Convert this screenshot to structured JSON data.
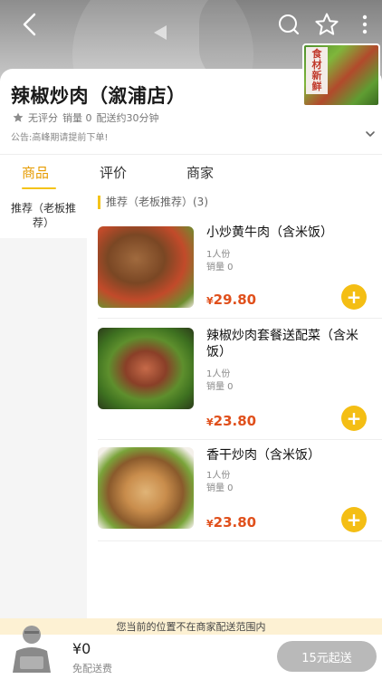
{
  "header": {
    "icons": [
      "back-icon",
      "search-icon",
      "star-icon",
      "more-icon"
    ]
  },
  "shop": {
    "name": "辣椒炒肉（溆浦店）",
    "rating": "无评分",
    "sales": "销量 0",
    "delivery": "配送约30分钟",
    "notice": "公告:高峰期请提前下单!",
    "logo_text": [
      "食",
      "材",
      "新",
      "鲜"
    ]
  },
  "tabs": [
    {
      "label": "商品",
      "active": true
    },
    {
      "label": "评价",
      "active": false
    },
    {
      "label": "商家",
      "active": false
    }
  ],
  "sidebar": {
    "items": [
      {
        "label": "推荐（老板推荐）",
        "active": true
      }
    ]
  },
  "section": {
    "title": "推荐（老板推荐）(3)"
  },
  "products": [
    {
      "name": "小炒黄牛肉（含米饭）",
      "portion": "1人份",
      "sales": "销量 0",
      "currency": "¥",
      "price": "29.80"
    },
    {
      "name": "辣椒炒肉套餐送配菜（含米饭）",
      "portion": "1人份",
      "sales": "销量 0",
      "currency": "¥",
      "price": "23.80"
    },
    {
      "name": "香干炒肉（含米饭）",
      "portion": "1人份",
      "sales": "销量 0",
      "currency": "¥",
      "price": "23.80"
    }
  ],
  "range_notice": "您当前的位置不在商家配送范围内",
  "cart": {
    "total": "¥0",
    "free_delivery": "免配送费",
    "checkout_label": "15元起送"
  },
  "colors": {
    "accent": "#f4be14",
    "active_tab": "#e69b00",
    "price": "#e0501c",
    "checkout_disabled": "#b9b9b9"
  }
}
